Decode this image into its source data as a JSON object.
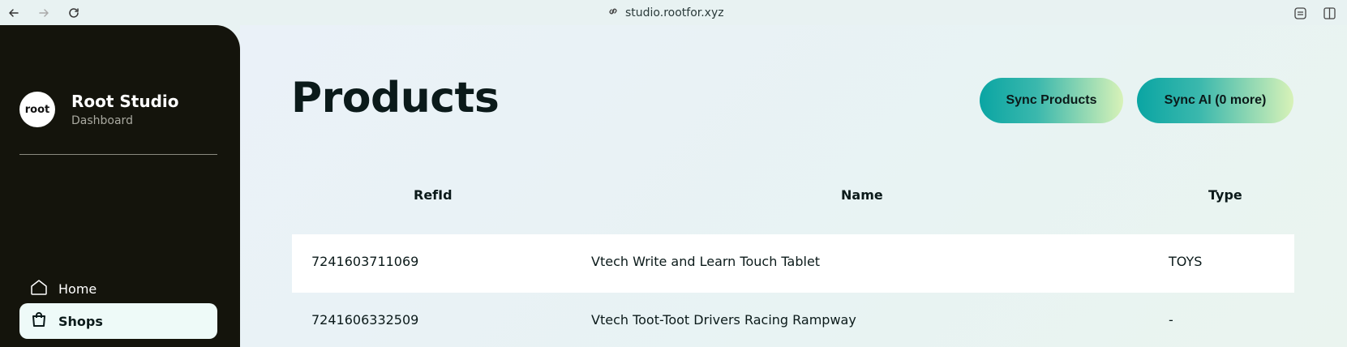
{
  "browser": {
    "url": "studio.rootfor.xyz"
  },
  "sidebar": {
    "logo_text": "root",
    "title": "Root Studio",
    "subtitle": "Dashboard",
    "items": [
      {
        "label": "Home",
        "icon": "home-icon"
      },
      {
        "label": "Shops",
        "icon": "shopping-bag-icon",
        "active": true
      }
    ]
  },
  "main": {
    "title": "Products",
    "buttons": {
      "sync_products": "Sync Products",
      "sync_ai": "Sync AI (0 more)"
    },
    "table": {
      "headers": [
        "RefId",
        "Name",
        "Type"
      ],
      "rows": [
        {
          "refid": "7241603711069",
          "name": "Vtech Write and Learn Touch Tablet",
          "type": "TOYS"
        },
        {
          "refid": "7241606332509",
          "name": "Vtech Toot-Toot Drivers Racing Rampway",
          "type": "-"
        }
      ]
    }
  },
  "colors": {
    "sidebar_bg": "#14140c",
    "accent_teal": "#0aa5a3",
    "accent_lime": "#d8f2b8",
    "active_item_bg": "#eefaf8"
  }
}
